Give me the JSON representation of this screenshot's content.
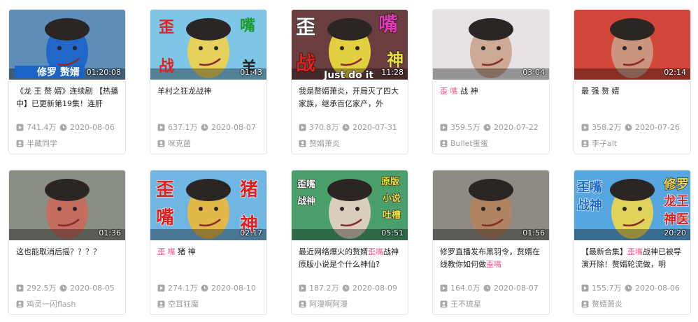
{
  "videos": [
    {
      "thumb_text": [
        "修罗 赘婿"
      ],
      "duration": "01:20:08",
      "title_parts": [
        {
          "t": "《龙 王 赘 婿》连续剧 【热播中】已更新第19集！连肝",
          "hl": false
        }
      ],
      "views": "741.4万",
      "date": "2020-08-06",
      "author": "半藏同学",
      "colors": {
        "bg": "#5f8fb8",
        "accent": "#1a63c9"
      }
    },
    {
      "thumb_text": [
        "歪",
        "嘴",
        "战",
        "羊"
      ],
      "duration": "01:43",
      "title_parts": [
        {
          "t": "羊村之狂龙战神",
          "hl": false
        }
      ],
      "views": "637.1万",
      "date": "2020-08-07",
      "author": "咪克菌",
      "colors": {
        "bg": "#7ec6e8",
        "accent": "#f2d24a"
      }
    },
    {
      "thumb_text": [
        "歪",
        "嘴",
        "战",
        "神",
        "Just do it"
      ],
      "duration": "11:28",
      "title_parts": [
        {
          "t": "我是赘婿萧炎，开局灭了四大家族，继承百亿家产，外",
          "hl": false
        }
      ],
      "views": "370.8万",
      "date": "2020-07-31",
      "author": "赘婿萧炎",
      "colors": {
        "bg": "#6b3f3f",
        "accent": "#f0e040"
      }
    },
    {
      "thumb_text": [],
      "duration": "03:04",
      "title_parts": [
        {
          "t": "歪 嘴",
          "hl": true
        },
        {
          "t": " 战 神",
          "hl": false
        }
      ],
      "views": "359.5万",
      "date": "2020-07-22",
      "author": "Bullet蛋蛋",
      "colors": {
        "bg": "#e6e2e6",
        "accent": "#c9a48c"
      }
    },
    {
      "thumb_text": [],
      "duration": "02:14",
      "title_parts": [
        {
          "t": "最 强 赘 婿",
          "hl": false
        }
      ],
      "views": "358.2万",
      "date": "2020-07-26",
      "author": "李子alt",
      "colors": {
        "bg": "#d3473a",
        "accent": "#c99c86"
      }
    },
    {
      "thumb_text": [],
      "duration": "01:36",
      "title_parts": [
        {
          "t": "这也能取消后摇？？？？",
          "hl": false
        }
      ],
      "views": "292.5万",
      "date": "2020-08-05",
      "author": "鸡灵一闪flash",
      "colors": {
        "bg": "#8a8f84",
        "accent": "#c96a5a"
      }
    },
    {
      "thumb_text": [
        "歪",
        "猪",
        "嘴",
        "神"
      ],
      "duration": "02:17",
      "title_parts": [
        {
          "t": "歪 嘴",
          "hl": true
        },
        {
          "t": " 猪 神",
          "hl": false
        }
      ],
      "views": "274.1万",
      "date": "2020-08-10",
      "author": "空耳狂魔",
      "colors": {
        "bg": "#6fb6e2",
        "accent": "#f0b83a"
      }
    },
    {
      "thumb_text": [
        "歪嘴",
        "战神",
        "原版",
        "小说",
        "吐槽"
      ],
      "duration": "05:51",
      "title_parts": [
        {
          "t": "最近网络爆火的赘婿",
          "hl": false
        },
        {
          "t": "歪嘴",
          "hl": true
        },
        {
          "t": "战神原版小说是个什么神仙?",
          "hl": false
        }
      ],
      "views": "187.2万",
      "date": "2020-08-09",
      "author": "阿漫啊阿漫",
      "colors": {
        "bg": "#49a06a",
        "accent": "#e9d2c4"
      }
    },
    {
      "thumb_text": [],
      "duration": "01:56",
      "title_parts": [
        {
          "t": "修罗直播发布黑羽令，赘婿在线教你如何做",
          "hl": false
        },
        {
          "t": "歪嘴",
          "hl": true
        }
      ],
      "views": "164.0万",
      "date": "2020-08-07",
      "author": "王不琉星",
      "colors": {
        "bg": "#8e8a84",
        "accent": "#b4825f"
      }
    },
    {
      "thumb_text": [
        "歪嘴",
        "战神",
        "修罗",
        "龙王",
        "神医"
      ],
      "duration": "20:20",
      "title_parts": [
        {
          "t": "【最新合集】",
          "hl": false
        },
        {
          "t": "歪嘴",
          "hl": true
        },
        {
          "t": "战神已被导演开除！赘婿轮流做，明",
          "hl": false
        }
      ],
      "views": "155.7万",
      "date": "2020-08-06",
      "author": "赘婿萧炎",
      "colors": {
        "bg": "#56a7df",
        "accent": "#f0d84a"
      }
    }
  ]
}
